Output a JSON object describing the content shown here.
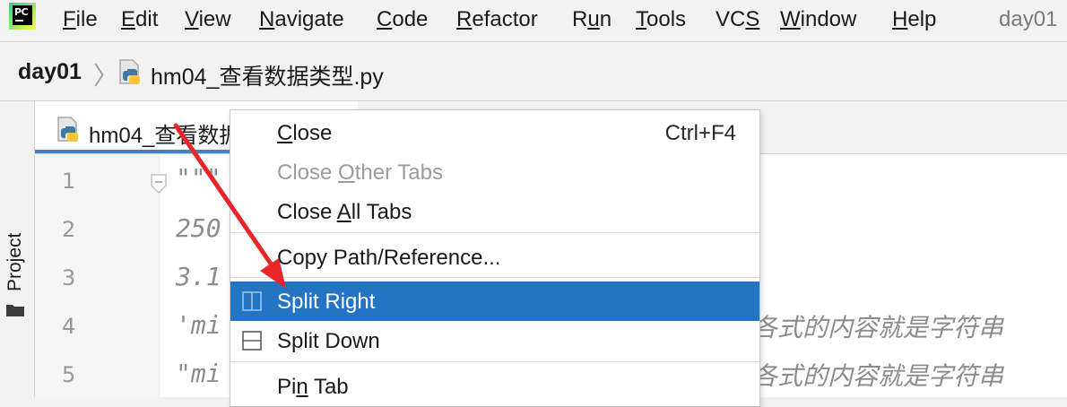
{
  "menubar": {
    "items": [
      {
        "id": "file",
        "pre": "",
        "u": "F",
        "post": "ile"
      },
      {
        "id": "edit",
        "pre": "",
        "u": "E",
        "post": "dit"
      },
      {
        "id": "view",
        "pre": "",
        "u": "V",
        "post": "iew"
      },
      {
        "id": "navigate",
        "pre": "",
        "u": "N",
        "post": "avigate"
      },
      {
        "id": "code",
        "pre": "",
        "u": "C",
        "post": "ode"
      },
      {
        "id": "refactor",
        "pre": "",
        "u": "R",
        "post": "efactor"
      },
      {
        "id": "run",
        "pre": "R",
        "u": "u",
        "post": "n"
      },
      {
        "id": "tools",
        "pre": "",
        "u": "T",
        "post": "ools"
      },
      {
        "id": "vcs",
        "pre": "VC",
        "u": "S",
        "post": ""
      },
      {
        "id": "window",
        "pre": "",
        "u": "W",
        "post": "indow"
      },
      {
        "id": "help",
        "pre": "",
        "u": "H",
        "post": "elp"
      }
    ],
    "project_title": "day01"
  },
  "breadcrumb": {
    "project": "day01",
    "separator": "〉",
    "file": "hm04_查看数据类型.py"
  },
  "left_strip": {
    "project_label": "Project"
  },
  "editor": {
    "tab_label": "hm04_查看数据类型.py",
    "line_numbers": [
      "1",
      "2",
      "3",
      "4",
      "5"
    ],
    "code_lines": [
      "\"\"\"",
      "250",
      "3.1",
      "'mi",
      "\"mi"
    ],
    "comments": [
      "各式的内容就是字符串",
      "各式的内容就是字符串"
    ]
  },
  "context_menu": {
    "close": {
      "pre": "",
      "u": "C",
      "post": "lose",
      "shortcut": "Ctrl+F4"
    },
    "close_other": {
      "pre": "Close ",
      "u": "O",
      "post": "ther Tabs"
    },
    "close_all": {
      "pre": "Close ",
      "u": "A",
      "post": "ll Tabs"
    },
    "copy_path": {
      "label": "Copy Path/Reference..."
    },
    "split_right": {
      "label": "Split Right"
    },
    "split_down": {
      "label": "Split Down"
    },
    "pin_tab": {
      "pre": "Pi",
      "u": "n",
      "post": " Tab"
    }
  },
  "colors": {
    "selection": "#2474c6",
    "tab_underline": "#4083c9",
    "annotation_arrow": "#e8262a"
  }
}
